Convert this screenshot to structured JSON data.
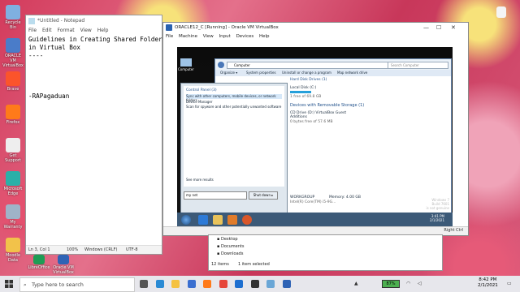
{
  "desktop": {
    "icons": [
      {
        "label": "Recycle Bin",
        "color": "#7fb0e0"
      },
      {
        "label": "ORACLE VM VirtualBox",
        "color": "#4a7cc9"
      },
      {
        "label": "Brave",
        "color": "#fb542b"
      },
      {
        "label": "Firefox",
        "color": "#ff7a1a"
      },
      {
        "label": "Get Support",
        "color": "#eeeeee"
      },
      {
        "label": "Microsoft Edge",
        "color": "#2ab0a8"
      },
      {
        "label": "My Warranty",
        "color": "#9fb3c8"
      },
      {
        "label": "Moodle Data",
        "color": "#f2c24a"
      }
    ],
    "bottom_icons": [
      {
        "label": "LibreOffice",
        "color": "#1f9d55"
      },
      {
        "label": "Oracle VM VirtualBox",
        "color": "#2f63b5"
      }
    ],
    "right_icon": {
      "label": "",
      "color": "#f4f4f4"
    }
  },
  "notepad": {
    "title": "*Untitled - Notepad",
    "menu": [
      "File",
      "Edit",
      "Format",
      "View",
      "Help"
    ],
    "content": "Guidelines in Creating Shared Folder\nin Virtual Box\n----\n\n\n\n\n-RAPagaduan",
    "status": {
      "position": "Ln 3, Col 1",
      "zoom": "100%",
      "eol": "Windows (CRLF)",
      "encoding": "UTF-8"
    }
  },
  "virtualbox": {
    "title": "ORACLE12_C [Running] - Oracle VM VirtualBox",
    "menu": [
      "File",
      "Machine",
      "View",
      "Input",
      "Devices",
      "Help"
    ],
    "right_ctrl": "Right Ctrl"
  },
  "guest": {
    "desktop_icon": "Computer",
    "explorer": {
      "address": "Computer",
      "search_placeholder": "Search Computer",
      "toolbar": [
        "Organize ▾",
        "System properties",
        "Uninstall or change a program",
        "Map network drive"
      ],
      "hdd_header": "Hard Disk Drives (1)",
      "hdd_name": "Local Disk (C:)",
      "hdd_free": "1 free of 69.8 GB",
      "removable_header": "Devices with Removable Storage (1)",
      "cd_name": "CD Drive (D:) VirtualBox Guest Additions",
      "cd_free": "0 bytes free of 57.6 MB",
      "workgroup": "WORKGROUP",
      "memory": "Memory: 4.00 GB",
      "processor": "Intel(R) Core(TM) i5-9G..."
    },
    "start_menu": {
      "section": "Control Panel (3)",
      "items": [
        "Sync with other computers, mobile devices, or network folders",
        "Device Manager",
        "Scan for spyware and other potentially unwanted software"
      ],
      "see_more": "See more results",
      "search_value": "my net",
      "shutdown": "Shut down ▸"
    },
    "clock": {
      "time": "3:41 PM",
      "date": "2/1/2021"
    },
    "watermark": [
      "Windows 7",
      "Build 7601",
      "is not genuine"
    ]
  },
  "bg_explorer": {
    "items": [
      "Desktop",
      "Documents",
      "Downloads"
    ],
    "status": "12 items",
    "selected": "1 item selected"
  },
  "taskbar": {
    "search_placeholder": "Type here to search",
    "battery": "87%",
    "time": "8:42 PM",
    "date": "2/1/2021",
    "apps": [
      {
        "name": "task-view",
        "color": "#555555"
      },
      {
        "name": "edge",
        "color": "#2a8ad4"
      },
      {
        "name": "file-explorer",
        "color": "#f5c242"
      },
      {
        "name": "store",
        "color": "#3b6fd0"
      },
      {
        "name": "firefox",
        "color": "#ff7a1a"
      },
      {
        "name": "chrome",
        "color": "#e6463b"
      },
      {
        "name": "mail",
        "color": "#1e6fd0"
      },
      {
        "name": "camera",
        "color": "#333333"
      },
      {
        "name": "notepad",
        "color": "#6aa6d6"
      },
      {
        "name": "virtualbox",
        "color": "#2f63b5"
      }
    ]
  }
}
